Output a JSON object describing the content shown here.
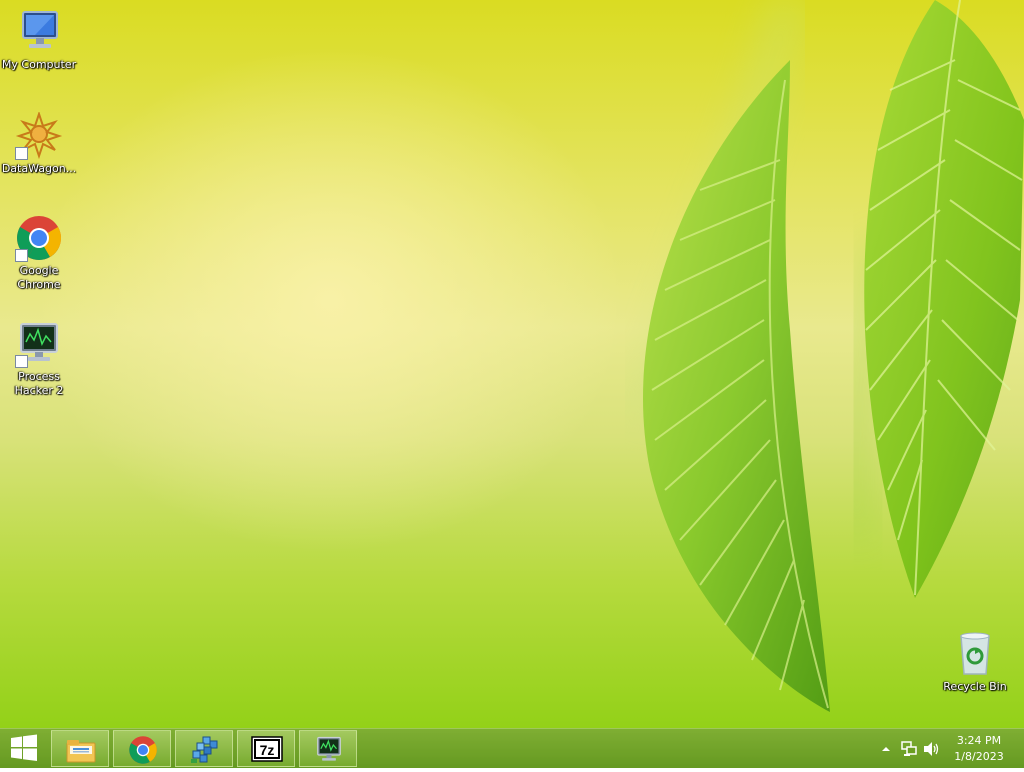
{
  "desktop": {
    "icons": [
      {
        "label": "My Computer"
      },
      {
        "label": "DataWagon..."
      },
      {
        "label": "Google Chrome"
      },
      {
        "label": "Process Hacker 2"
      },
      {
        "label": "Recycle Bin"
      }
    ]
  },
  "taskbar": {
    "pinned": [
      {
        "icon": "file-explorer-icon"
      },
      {
        "icon": "chrome-icon"
      },
      {
        "icon": "registry-editor-icon"
      },
      {
        "icon": "7zip-icon",
        "text": "7z"
      },
      {
        "icon": "process-hacker-icon"
      }
    ],
    "tray": {
      "time": "3:24 PM",
      "date": "1/8/2023"
    }
  },
  "colors": {
    "taskbar": "#6a9e22",
    "wallpaper_top": "#dadc22",
    "wallpaper_bottom": "#93d118",
    "leaf": "#7cc219"
  }
}
